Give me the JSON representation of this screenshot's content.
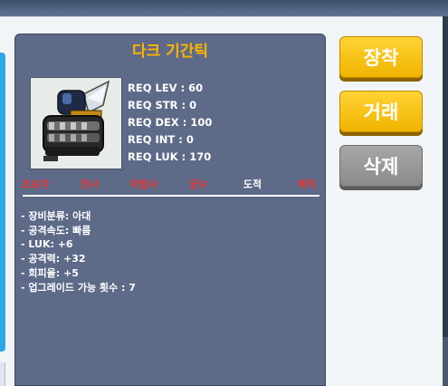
{
  "item": {
    "name": "다크 기간틱",
    "requirements": [
      "REQ LEV : 60",
      "REQ STR : 0",
      "REQ DEX : 100",
      "REQ INT : 0",
      "REQ LUK : 170"
    ],
    "jobs": [
      {
        "label": "초보자",
        "allowed": false
      },
      {
        "label": "전사",
        "allowed": false
      },
      {
        "label": "마법사",
        "allowed": false
      },
      {
        "label": "궁수",
        "allowed": false
      },
      {
        "label": "도적",
        "allowed": true
      },
      {
        "label": "해적",
        "allowed": false
      }
    ],
    "description": [
      "- 장비분류: 아대",
      "- 공격속도: 빠름",
      "- LUK: +6",
      "- 공격력: +32",
      "- 회피율: +5",
      "- 업그레이드 가능 횟수 : 7"
    ],
    "image_icon": "dark-claw-icon"
  },
  "actions": {
    "equip": "장착",
    "trade": "거래",
    "delete": "삭제"
  },
  "colors": {
    "title": "#ffb300",
    "job_disallowed": "#e63333",
    "job_allowed": "#ffffff",
    "panel": "#5d6a88",
    "button_active": "#f5c518",
    "button_disabled": "#9a9a9a"
  }
}
